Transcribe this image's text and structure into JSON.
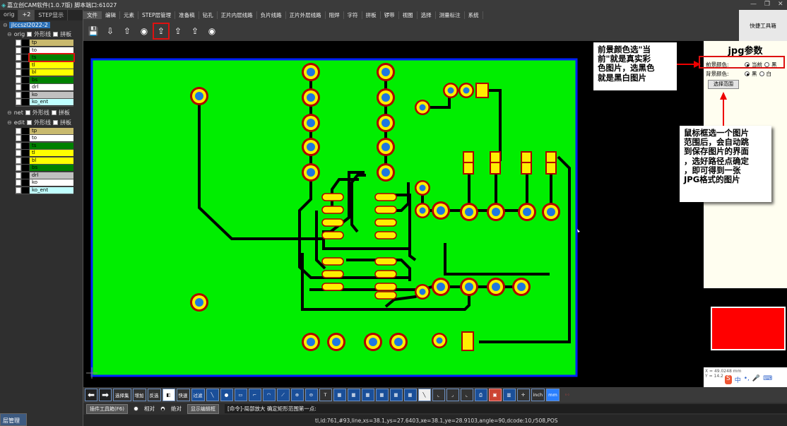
{
  "window": {
    "title": "嘉立创CAM软件(1.0.7版) 脚本端口:61027"
  },
  "left_panel": {
    "tabs": [
      "orig",
      "+2",
      "STEP显示"
    ],
    "root": "jlccszl2022-2",
    "groups": [
      {
        "name": "orig",
        "opts": [
          "外形线",
          "拼板"
        ],
        "layers": [
          {
            "name": "tp",
            "color": "#c8b96e"
          },
          {
            "name": "to",
            "color": "#ffffff"
          },
          {
            "name": "ts",
            "color": "#008000"
          },
          {
            "name": "tl",
            "color": "#ffff00"
          },
          {
            "name": "bl",
            "color": "#ffff00"
          },
          {
            "name": "bs",
            "color": "#008000"
          },
          {
            "name": "drl",
            "color": "#ffffff"
          },
          {
            "name": "ko",
            "color": "#c0c0c0"
          },
          {
            "name": "ko_ent",
            "color": "#c0ffff"
          }
        ]
      },
      {
        "name": "net",
        "opts": [
          "外形线",
          "拼板"
        ],
        "layers": []
      },
      {
        "name": "edit",
        "opts": [
          "外形线",
          "拼板"
        ],
        "layers": [
          {
            "name": "tp",
            "color": "#c8b96e"
          },
          {
            "name": "to",
            "color": "#ffffff"
          },
          {
            "name": "ts",
            "color": "#008000"
          },
          {
            "name": "tl",
            "color": "#ffff00"
          },
          {
            "name": "bl",
            "color": "#ffff00"
          },
          {
            "name": "bs",
            "color": "#008000"
          },
          {
            "name": "drl",
            "color": "#c0c0c0"
          },
          {
            "name": "ko",
            "color": "#ffffff"
          },
          {
            "name": "ko_ent",
            "color": "#c0ffff"
          }
        ]
      }
    ],
    "bottom_tab": "层管理"
  },
  "menu": [
    "文件",
    "编辑",
    "元素",
    "STEP层管理",
    "准备稿",
    "钻孔",
    "正片内层线路",
    "负片线路",
    "正片外层线路",
    "阻焊",
    "字符",
    "拼板",
    "锣带",
    "视图",
    "选择",
    "测量标注",
    "系统"
  ],
  "quick_tools": "快捷工具箱",
  "right_panel": {
    "title": "jpg参数",
    "fg_label": "前景颜色:",
    "fg_options": [
      "当前",
      "黑"
    ],
    "bg_label": "背景颜色:",
    "bg_options": [
      "黑",
      "白"
    ],
    "select_btn": "选择范围",
    "coords": [
      "X = 49.0248 mm",
      "Y = 14.2"
    ]
  },
  "callouts": {
    "c1": [
      "前景颜色选\"当",
      "前\"就是真实彩",
      "色图片，选黑色",
      "就是黑白图片"
    ],
    "c2": [
      "鼠标框选一个图片",
      "范围后，会自动跳",
      "到保存图片的界面",
      "，选好路径点确定",
      "，即可得到一张",
      "JPG格式的图片"
    ]
  },
  "bottom_tools": {
    "labels": [
      "选择集",
      "增加",
      "反选",
      "快速",
      "过滤",
      "inch",
      "mm"
    ]
  },
  "cmd": {
    "tool_btn": "插件工具箱(F6)",
    "radio1": "相对",
    "radio2": "绝对",
    "btn2": "显示编辑框",
    "text": "[命令]-局部放大 确定矩形范围第一点:"
  },
  "status": "tl,id:761,#93,line,xs=38.1,ys=27.6403,xe=38.1,ye=28.9103,angle=90,dcode:10,r508,POS",
  "ime": [
    "S",
    "中",
    "•,",
    "🎤",
    "⌨"
  ],
  "colors": {
    "board": "#00ee00",
    "copper": "#000000",
    "pad": "#ffee00",
    "ring": "#aa0000",
    "drill": "#1f77e0",
    "outline": "#0022ff",
    "accent": "#d11"
  }
}
